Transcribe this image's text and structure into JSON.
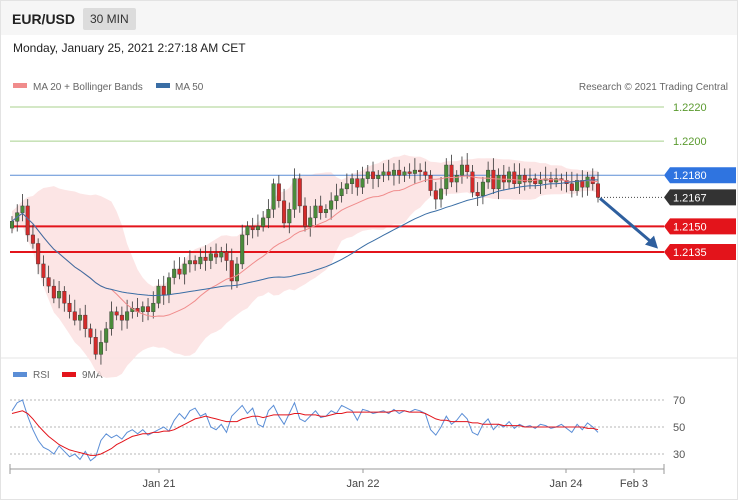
{
  "header": {
    "symbol": "EUR/USD",
    "timeframe": "30 MIN",
    "datetime": "Monday, January 25, 2021 2:27:18 AM CET"
  },
  "legend": {
    "ma20": "MA 20 + Bollinger Bands",
    "ma50": "MA 50",
    "copyright": "Research © 2021 Trading Central",
    "rsi": "RSI",
    "ma9": "9MA"
  },
  "colors": {
    "ma20": "#f08c8c",
    "ma50": "#3a6ea5",
    "bollinger": "#fbe1e1",
    "candle_up": "#4a8b3b",
    "candle_down": "#d42a2a",
    "resistance": "#a8d08d",
    "pivot_line": "#5b8ed6",
    "support": "#e3141b",
    "last_price": "#333333",
    "arrow": "#2e5f9e",
    "rsi": "#5b8ed6"
  },
  "chart_data": [
    {
      "type": "candlestick",
      "x_ticks": [
        "Jan 21",
        "Jan 22",
        "Jan 24",
        "Feb 3"
      ],
      "ylim": [
        1.21,
        1.223
      ],
      "levels": [
        {
          "value": "1.2220",
          "kind": "resistance",
          "color": "#a8d08d",
          "label_bg": "",
          "text_color": "#5a9a2e"
        },
        {
          "value": "1.2200",
          "kind": "resistance",
          "color": "#a8d08d",
          "label_bg": "",
          "text_color": "#5a9a2e"
        },
        {
          "value": "1.2180",
          "kind": "pivot",
          "color": "#5b8ed6",
          "label_bg": "#2f74e0",
          "text_color": "#ffffff"
        },
        {
          "value": "1.2167",
          "kind": "last",
          "color": "#555555",
          "label_bg": "#333333",
          "text_color": "#ffffff"
        },
        {
          "value": "1.2150",
          "kind": "support",
          "color": "#e3141b",
          "label_bg": "#e3141b",
          "text_color": "#ffffff"
        },
        {
          "value": "1.2135",
          "kind": "support",
          "color": "#e3141b",
          "label_bg": "#e3141b",
          "text_color": "#ffffff"
        }
      ],
      "close": [
        1.2153,
        1.2158,
        1.2162,
        1.2145,
        1.214,
        1.2128,
        1.212,
        1.2115,
        1.2108,
        1.2112,
        1.2105,
        1.21,
        1.2095,
        1.2098,
        1.209,
        1.2085,
        1.2075,
        1.2082,
        1.209,
        1.21,
        1.2098,
        1.2095,
        1.21,
        1.2102,
        1.21,
        1.2103,
        1.21,
        1.2105,
        1.2115,
        1.211,
        1.212,
        1.2125,
        1.2122,
        1.2128,
        1.213,
        1.2128,
        1.2132,
        1.213,
        1.2134,
        1.2132,
        1.2135,
        1.213,
        1.2118,
        1.2128,
        1.2145,
        1.215,
        1.2148,
        1.215,
        1.2155,
        1.216,
        1.2175,
        1.2165,
        1.2152,
        1.216,
        1.2178,
        1.2162,
        1.215,
        1.2155,
        1.2162,
        1.2158,
        1.216,
        1.2165,
        1.2168,
        1.2172,
        1.2175,
        1.2178,
        1.2173,
        1.2178,
        1.2182,
        1.2178,
        1.218,
        1.2182,
        1.218,
        1.2183,
        1.218,
        1.2182,
        1.2181,
        1.2183,
        1.2182,
        1.218,
        1.2171,
        1.2166,
        1.2172,
        1.2186,
        1.2176,
        1.218,
        1.2186,
        1.2182,
        1.217,
        1.2168,
        1.2176,
        1.2183,
        1.2172,
        1.218,
        1.2176,
        1.2182,
        1.2175,
        1.218,
        1.2176,
        1.2178,
        1.2175,
        1.2177,
        1.2178,
        1.2176,
        1.2178,
        1.2177,
        1.2175,
        1.2171,
        1.2177,
        1.2173,
        1.2179,
        1.2175,
        1.2167
      ],
      "rsi": {
        "ylim": [
          20,
          80
        ],
        "ticks": [
          "70",
          "50",
          "30"
        ],
        "values": [
          62,
          68,
          70,
          58,
          48,
          40,
          35,
          33,
          30,
          36,
          32,
          28,
          30,
          26,
          32,
          25,
          28,
          40,
          45,
          42,
          44,
          41,
          46,
          48,
          45,
          48,
          44,
          46,
          48,
          50,
          47,
          55,
          60,
          56,
          62,
          64,
          58,
          60,
          50,
          48,
          52,
          46,
          58,
          62,
          66,
          60,
          64,
          52,
          50,
          62,
          66,
          58,
          52,
          60,
          68,
          56,
          54,
          58,
          62,
          57,
          58,
          62,
          60,
          66,
          64,
          62,
          55,
          63,
          62,
          60,
          61,
          62,
          60,
          63,
          60,
          62,
          61,
          63,
          62,
          60,
          48,
          44,
          50,
          58,
          52,
          55,
          60,
          56,
          46,
          44,
          52,
          56,
          48,
          52,
          50,
          54,
          49,
          52,
          50,
          51,
          49,
          52,
          51,
          49,
          50,
          52,
          49,
          46,
          52,
          48,
          53,
          50,
          46
        ],
        "ma9": [
          60,
          61,
          62,
          60,
          56,
          51,
          47,
          43,
          40,
          37,
          35,
          33,
          32,
          31,
          30,
          29,
          29,
          30,
          32,
          34,
          37,
          39,
          41,
          43,
          44,
          45,
          45,
          46,
          46,
          47,
          47,
          48,
          50,
          52,
          54,
          56,
          57,
          58,
          57,
          56,
          55,
          54,
          54,
          54,
          56,
          57,
          58,
          58,
          57,
          58,
          59,
          59,
          59,
          59,
          60,
          60,
          59,
          59,
          59,
          58,
          58,
          59,
          60,
          60,
          61,
          61,
          61,
          61,
          61,
          61,
          61,
          61,
          61,
          62,
          62,
          62,
          61,
          61,
          61,
          60,
          58,
          56,
          55,
          55,
          54,
          54,
          54,
          54,
          53,
          53,
          52,
          52,
          52,
          52,
          51,
          51,
          51,
          51,
          50,
          50,
          50,
          50,
          50,
          50,
          50,
          50,
          50,
          50,
          50,
          50,
          49,
          49,
          48
        ]
      }
    }
  ]
}
